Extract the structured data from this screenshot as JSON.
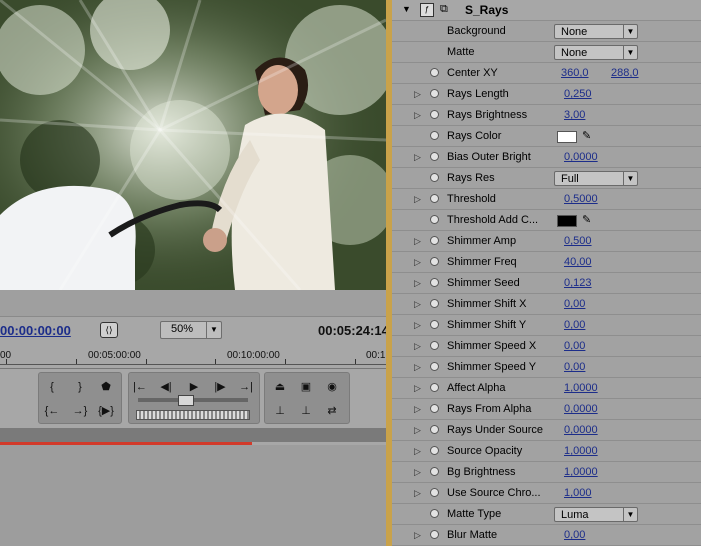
{
  "monitor": {
    "timecode_current": "00:00:00:00",
    "timecode_duration": "00:05:24:14",
    "zoom": "50%",
    "ruler_labels": [
      "00",
      "00:05:00:00",
      "00:10:00:00",
      "00:1"
    ]
  },
  "effect": {
    "name": "S_Rays",
    "params": [
      {
        "label": "Background",
        "type": "select",
        "value": "None",
        "stopwatch": false,
        "twirl": false
      },
      {
        "label": "Matte",
        "type": "select",
        "value": "None",
        "stopwatch": false,
        "twirl": false
      },
      {
        "label": "Center XY",
        "type": "point",
        "value": "360,0",
        "value2": "288,0",
        "stopwatch": true,
        "twirl": false
      },
      {
        "label": "Rays Length",
        "type": "number",
        "value": "0,250",
        "stopwatch": true,
        "twirl": true
      },
      {
        "label": "Rays Brightness",
        "type": "number",
        "value": "3,00",
        "stopwatch": true,
        "twirl": true
      },
      {
        "label": "Rays Color",
        "type": "color",
        "value": "#ffffff",
        "stopwatch": true,
        "twirl": false
      },
      {
        "label": "Bias Outer Bright",
        "type": "number",
        "value": "0,0000",
        "stopwatch": true,
        "twirl": true
      },
      {
        "label": "Rays Res",
        "type": "select",
        "value": "Full",
        "stopwatch": true,
        "twirl": false
      },
      {
        "label": "Threshold",
        "type": "number",
        "value": "0,5000",
        "stopwatch": true,
        "twirl": true
      },
      {
        "label": "Threshold Add C...",
        "type": "color",
        "value": "#000000",
        "stopwatch": true,
        "twirl": false
      },
      {
        "label": "Shimmer Amp",
        "type": "number",
        "value": "0,500",
        "stopwatch": true,
        "twirl": true
      },
      {
        "label": "Shimmer Freq",
        "type": "number",
        "value": "40,00",
        "stopwatch": true,
        "twirl": true
      },
      {
        "label": "Shimmer Seed",
        "type": "number",
        "value": "0,123",
        "stopwatch": true,
        "twirl": true
      },
      {
        "label": "Shimmer Shift X",
        "type": "number",
        "value": "0,00",
        "stopwatch": true,
        "twirl": true
      },
      {
        "label": "Shimmer Shift Y",
        "type": "number",
        "value": "0,00",
        "stopwatch": true,
        "twirl": true
      },
      {
        "label": "Shimmer Speed X",
        "type": "number",
        "value": "0,00",
        "stopwatch": true,
        "twirl": true
      },
      {
        "label": "Shimmer Speed Y",
        "type": "number",
        "value": "0,00",
        "stopwatch": true,
        "twirl": true
      },
      {
        "label": "Affect Alpha",
        "type": "number",
        "value": "1,0000",
        "stopwatch": true,
        "twirl": true
      },
      {
        "label": "Rays From Alpha",
        "type": "number",
        "value": "0,0000",
        "stopwatch": true,
        "twirl": true
      },
      {
        "label": "Rays Under Source",
        "type": "number",
        "value": "0,0000",
        "stopwatch": true,
        "twirl": true
      },
      {
        "label": "Source Opacity",
        "type": "number",
        "value": "1,0000",
        "stopwatch": true,
        "twirl": true
      },
      {
        "label": "Bg Brightness",
        "type": "number",
        "value": "1,0000",
        "stopwatch": true,
        "twirl": true
      },
      {
        "label": "Use Source Chro...",
        "type": "number",
        "value": "1,000",
        "stopwatch": true,
        "twirl": true
      },
      {
        "label": "Matte Type",
        "type": "select",
        "value": "Luma",
        "stopwatch": true,
        "twirl": false
      },
      {
        "label": "Blur Matte",
        "type": "number",
        "value": "0,00",
        "stopwatch": true,
        "twirl": true
      }
    ]
  },
  "icons": {
    "twirl": "triangle-right-icon",
    "stopwatch": "stopwatch-icon",
    "eyedropper": "eyedropper-icon"
  }
}
